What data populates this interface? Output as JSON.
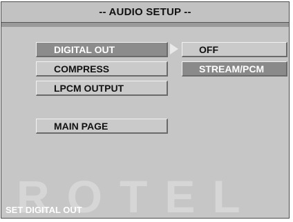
{
  "header": {
    "title": "-- AUDIO SETUP --"
  },
  "menu": {
    "items": [
      {
        "label": "DIGITAL OUT",
        "selected": true
      },
      {
        "label": "COMPRESS",
        "selected": false
      },
      {
        "label": "LPCM OUTPUT",
        "selected": false
      },
      {
        "label": "MAIN PAGE",
        "selected": false
      }
    ]
  },
  "options": {
    "items": [
      {
        "label": "OFF",
        "highlighted": false
      },
      {
        "label": "STREAM/PCM",
        "highlighted": true
      }
    ]
  },
  "watermark": {
    "text": "ROTEL"
  },
  "status": {
    "text": "SET DIGITAL OUT"
  },
  "colors": {
    "background": "#c6c6c6",
    "selected": "#8c8c8c",
    "status_text": "#ffffff"
  },
  "icons": {
    "pointer": "right-arrow-icon"
  }
}
